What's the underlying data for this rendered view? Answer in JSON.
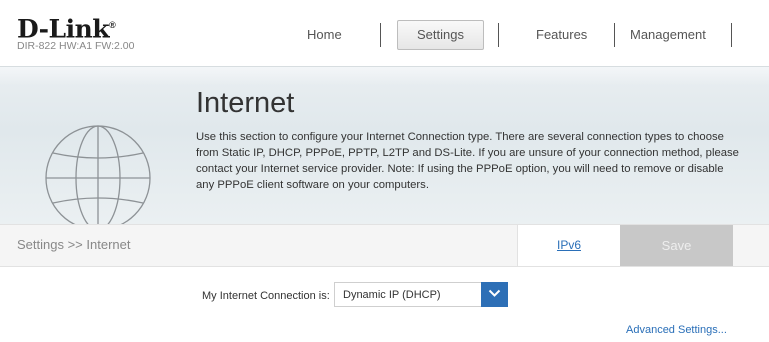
{
  "brand": {
    "logo": "D-Link",
    "registered": "®",
    "firmware": "DIR-822 HW:A1 FW:2.00"
  },
  "nav": {
    "items": [
      {
        "label": "Home"
      },
      {
        "label": "Settings",
        "active": true
      },
      {
        "label": "Features"
      },
      {
        "label": "Management"
      }
    ]
  },
  "banner": {
    "title": "Internet",
    "icon": "globe-icon",
    "description": "Use this section to configure your Internet Connection type. There are several connection types to choose from Static IP, DHCP, PPPoE, PPTP, L2TP and DS-Lite. If you are unsure of your connection method, please contact your Internet service provider. Note: If using the PPPoE option, you will need to remove or disable any PPPoE client software on your computers."
  },
  "toolbar": {
    "breadcrumb": "Settings >> Internet",
    "ipv6_link": "IPv6",
    "save_label": "Save"
  },
  "connection": {
    "label": "My Internet Connection is:",
    "selected": "Dynamic IP (DHCP)",
    "advanced_link": "Advanced Settings..."
  },
  "colors": {
    "accent": "#2d6fb6",
    "link": "#2a6fb8",
    "save_disabled": "#c8c8c8"
  }
}
